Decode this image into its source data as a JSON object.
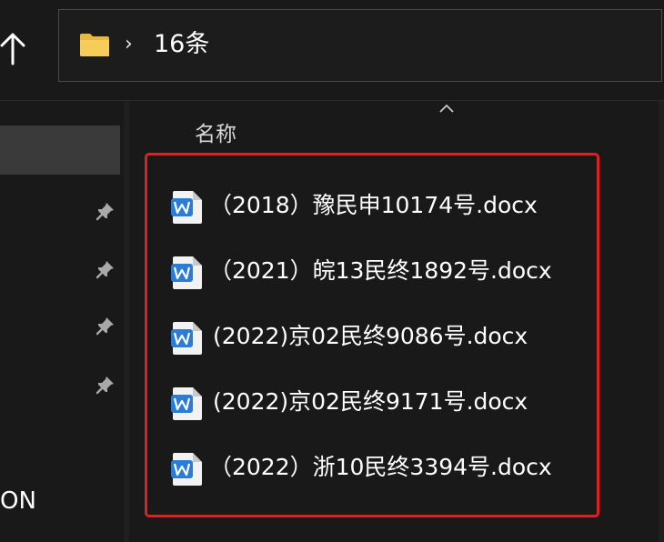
{
  "toolbar": {
    "up_icon": "arrow-up-icon"
  },
  "address_bar": {
    "folder_icon": "folder-icon",
    "chevron_icon": "chevron-right-icon",
    "chevron": "›",
    "current_folder": "16条"
  },
  "file_list": {
    "column_header": "名称",
    "sort_icon": "sort-up-icon",
    "highlight_color": "#e02020",
    "files": [
      {
        "name": "（2018）豫民申10174号.docx",
        "icon": "word-doc-icon"
      },
      {
        "name": "（2021）皖13民终1892号.docx",
        "icon": "word-doc-icon"
      },
      {
        "name": "(2022)京02民终9086号.docx",
        "icon": "word-doc-icon"
      },
      {
        "name": "(2022)京02民终9171号.docx",
        "icon": "word-doc-icon"
      },
      {
        "name": "（2022）浙10民终3394号.docx",
        "icon": "word-doc-icon"
      }
    ]
  },
  "nav_pane": {
    "pin_icon": "pin-icon",
    "partial_label": "ON"
  }
}
